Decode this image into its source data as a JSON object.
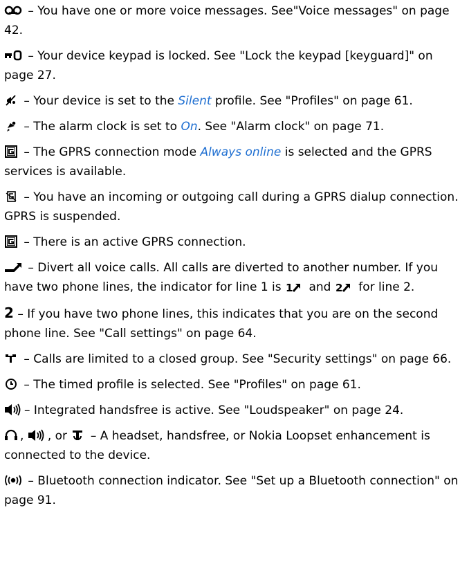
{
  "entries": {
    "voice": {
      "icon": "voice-message-icon",
      "text": " – You have one or more voice messages. See\"Voice messages\" on page 42."
    },
    "keypad": {
      "icon": "keypad-lock-icon",
      "text": " – Your device keypad is locked. See \"Lock the keypad [keyguard]\" on page 27."
    },
    "silent": {
      "icon": "silent-profile-icon",
      "pre": " – Your device is set to the ",
      "em": "Silent",
      "post": " profile. See \"Profiles\" on page 61."
    },
    "alarm": {
      "icon": "alarm-clock-icon",
      "pre": " – The alarm clock is set to ",
      "em": "On",
      "post": ". See \"Alarm clock\" on page 71."
    },
    "gprs_always": {
      "icon": "gprs-available-icon",
      "pre": " – The GPRS connection mode ",
      "em": "Always online",
      "post": " is selected and the GPRS services is available."
    },
    "gprs_suspended": {
      "icon": "gprs-suspended-icon",
      "text": " – You have an incoming or outgoing call during a GPRS dialup connection. GPRS is suspended."
    },
    "gprs_active": {
      "icon": "gprs-active-icon",
      "text": " – There is an active GPRS connection."
    },
    "divert": {
      "icon": "divert-calls-icon",
      "pre": " – Divert all voice calls. All calls are diverted to another number. If you have two phone lines, the indicator for line 1 is ",
      "mid": " and ",
      "post": " for line 2.",
      "line1_icon": "divert-line1-icon",
      "line2_icon": "divert-line2-icon"
    },
    "line2": {
      "icon": "line-2-icon",
      "glyph": "2",
      "text": " – If you have two phone lines, this indicates that you are on the second phone line. See \"Call settings\" on page 64."
    },
    "closed_group": {
      "icon": "closed-group-icon",
      "text": " – Calls are limited to a closed group. See \"Security settings\" on page 66."
    },
    "timed": {
      "icon": "timed-profile-icon",
      "text": " – The timed profile is selected. See \"Profiles\" on page 61."
    },
    "handsfree": {
      "icon": "integrated-handsfree-icon",
      "text": "– Integrated handsfree is active. See \"Loudspeaker\" on page 24."
    },
    "enhancement": {
      "icons": [
        "headset-icon",
        "handsfree-icon",
        "loopset-icon"
      ],
      "sep1": ", ",
      "sep2": ", or ",
      "text": " – A headset, handsfree, or Nokia Loopset enhancement is connected to the device."
    },
    "bluetooth": {
      "icon": "bluetooth-icon",
      "text": " – Bluetooth connection indicator. See \"Set up a Bluetooth connection\" on page 91."
    }
  },
  "colors": {
    "link": "#1f6fd1",
    "text": "#000000"
  }
}
